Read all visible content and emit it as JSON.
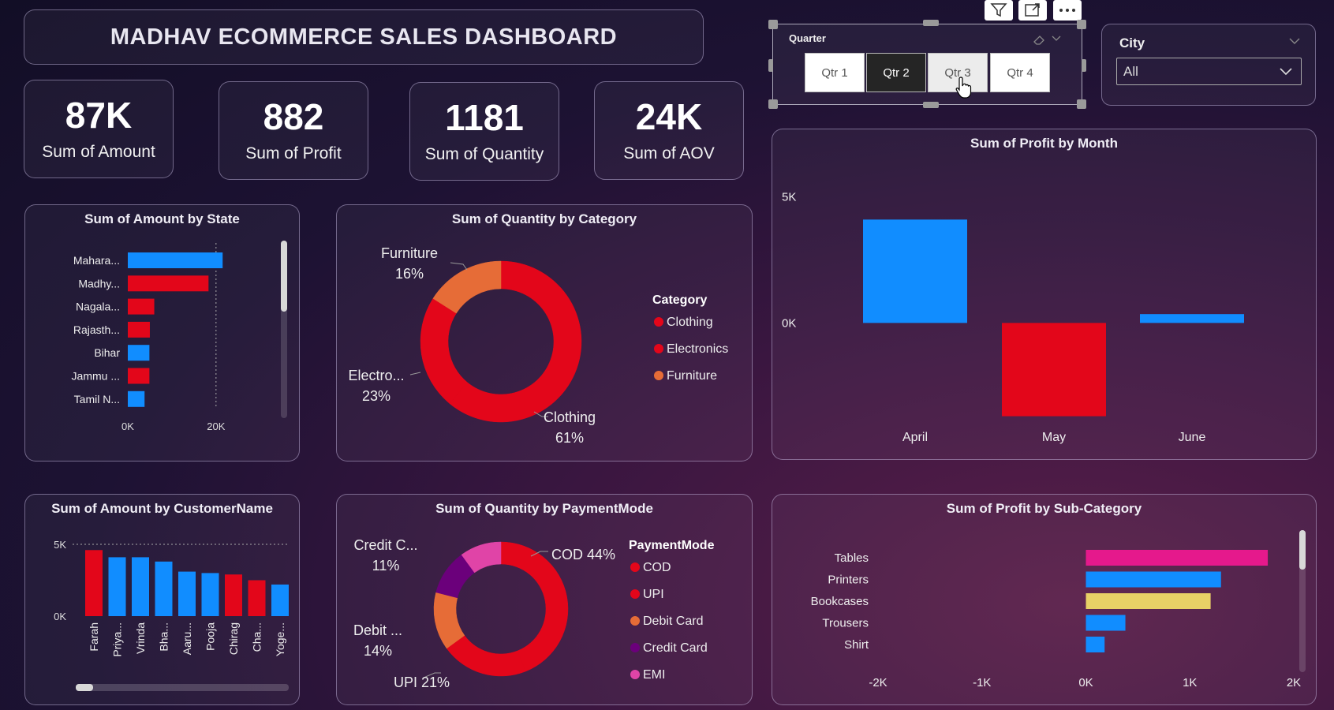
{
  "dashboard_title": "MADHAV ECOMMERCE SALES DASHBOARD",
  "kpis": [
    {
      "value": "87K",
      "label": "Sum of Amount"
    },
    {
      "value": "882",
      "label": "Sum of Profit"
    },
    {
      "value": "1181",
      "label": "Sum of Quantity"
    },
    {
      "value": "24K",
      "label": "Sum of AOV"
    }
  ],
  "quarter_slicer": {
    "title": "Quarter",
    "options": [
      "Qtr 1",
      "Qtr 2",
      "Qtr 3",
      "Qtr 4"
    ],
    "selected": "Qtr 2",
    "hovered": "Qtr 3"
  },
  "city_slicer": {
    "title": "City",
    "value": "All"
  },
  "colors": {
    "blue": "#118DFF",
    "red": "#E3061A",
    "orange": "#E66C37",
    "purple": "#6B007B",
    "pink": "#E044A7",
    "magenta": "#E5198C",
    "yellow": "#E8D166"
  },
  "chart_data": [
    {
      "id": "amount_by_state",
      "type": "bar",
      "orientation": "horizontal",
      "title": "Sum of Amount by State",
      "categories": [
        "Mahara...",
        "Madhy...",
        "Nagala...",
        "Rajasth...",
        "Bihar",
        "Jammu ...",
        "Tamil N..."
      ],
      "values": [
        21500,
        18300,
        6000,
        5000,
        4900,
        4900,
        3800
      ],
      "colors": [
        "#118DFF",
        "#E3061A",
        "#E3061A",
        "#E3061A",
        "#118DFF",
        "#E3061A",
        "#118DFF"
      ],
      "xticks": [
        "0K",
        "20K"
      ],
      "xlim": [
        0,
        24000
      ]
    },
    {
      "id": "quantity_by_category",
      "type": "pie",
      "donut": true,
      "title": "Sum of Quantity by Category",
      "legend_title": "Category",
      "slices": [
        {
          "label": "Clothing",
          "value": 61,
          "color": "#E3061A",
          "display": "Clothing",
          "pct": "61%"
        },
        {
          "label": "Electronics",
          "value": 23,
          "color": "#E3061A",
          "display": "Electro...",
          "pct": "23%"
        },
        {
          "label": "Furniture",
          "value": 16,
          "color": "#E66C37",
          "display": "Furniture",
          "pct": "16%"
        }
      ]
    },
    {
      "id": "profit_by_month",
      "type": "bar",
      "title": "Sum of Profit by Month",
      "categories": [
        "April",
        "May",
        "June"
      ],
      "values": [
        4100,
        -3700,
        350
      ],
      "colors": [
        "#118DFF",
        "#E3061A",
        "#118DFF"
      ],
      "yticks": [
        {
          "value": 5000,
          "label": "5K"
        },
        {
          "value": 0,
          "label": "0K"
        }
      ],
      "ylim": [
        -3900,
        5800
      ]
    },
    {
      "id": "amount_by_customer",
      "type": "bar",
      "title": "Sum of Amount by CustomerName",
      "categories": [
        "Farah",
        "Priya...",
        "Vrinda",
        "Bha...",
        "Aaru...",
        "Pooja",
        "Chirag",
        "Cha...",
        "Yoge..."
      ],
      "values": [
        4600,
        4100,
        4100,
        3800,
        3100,
        3000,
        2900,
        2500,
        2200
      ],
      "colors": [
        "#E3061A",
        "#118DFF",
        "#118DFF",
        "#118DFF",
        "#118DFF",
        "#118DFF",
        "#E3061A",
        "#E3061A",
        "#118DFF"
      ],
      "yticks": [
        {
          "value": 5000,
          "label": "5K"
        },
        {
          "value": 0,
          "label": "0K"
        }
      ],
      "ylim": [
        0,
        5000
      ]
    },
    {
      "id": "quantity_by_paymentmode",
      "type": "pie",
      "donut": true,
      "title": "Sum of Quantity by PaymentMode",
      "legend_title": "PaymentMode",
      "slices": [
        {
          "label": "COD",
          "value": 44,
          "color": "#E3061A",
          "display": "COD",
          "pct": "44%"
        },
        {
          "label": "UPI",
          "value": 21,
          "color": "#E3061A",
          "display": "UPI",
          "pct": "21%"
        },
        {
          "label": "Debit Card",
          "value": 14,
          "color": "#E66C37",
          "display": "Debit ...",
          "pct": "14%"
        },
        {
          "label": "Credit Card",
          "value": 11,
          "color": "#6B007B",
          "display": "Credit C...",
          "pct": "11%"
        },
        {
          "label": "EMI",
          "value": 10,
          "color": "#E044A7",
          "display": "EMI",
          "pct": ""
        }
      ]
    },
    {
      "id": "profit_by_subcategory",
      "type": "bar",
      "orientation": "horizontal",
      "title": "Sum of Profit by Sub-Category",
      "categories": [
        "Tables",
        "Printers",
        "Bookcases",
        "Trousers",
        "Shirt"
      ],
      "values": [
        1750,
        1300,
        1200,
        380,
        180
      ],
      "colors": [
        "#E5198C",
        "#118DFF",
        "#E8D166",
        "#118DFF",
        "#118DFF"
      ],
      "xticks": [
        "-2K",
        "-1K",
        "0K",
        "1K",
        "2K"
      ],
      "xlim": [
        -2000,
        2000
      ]
    }
  ]
}
